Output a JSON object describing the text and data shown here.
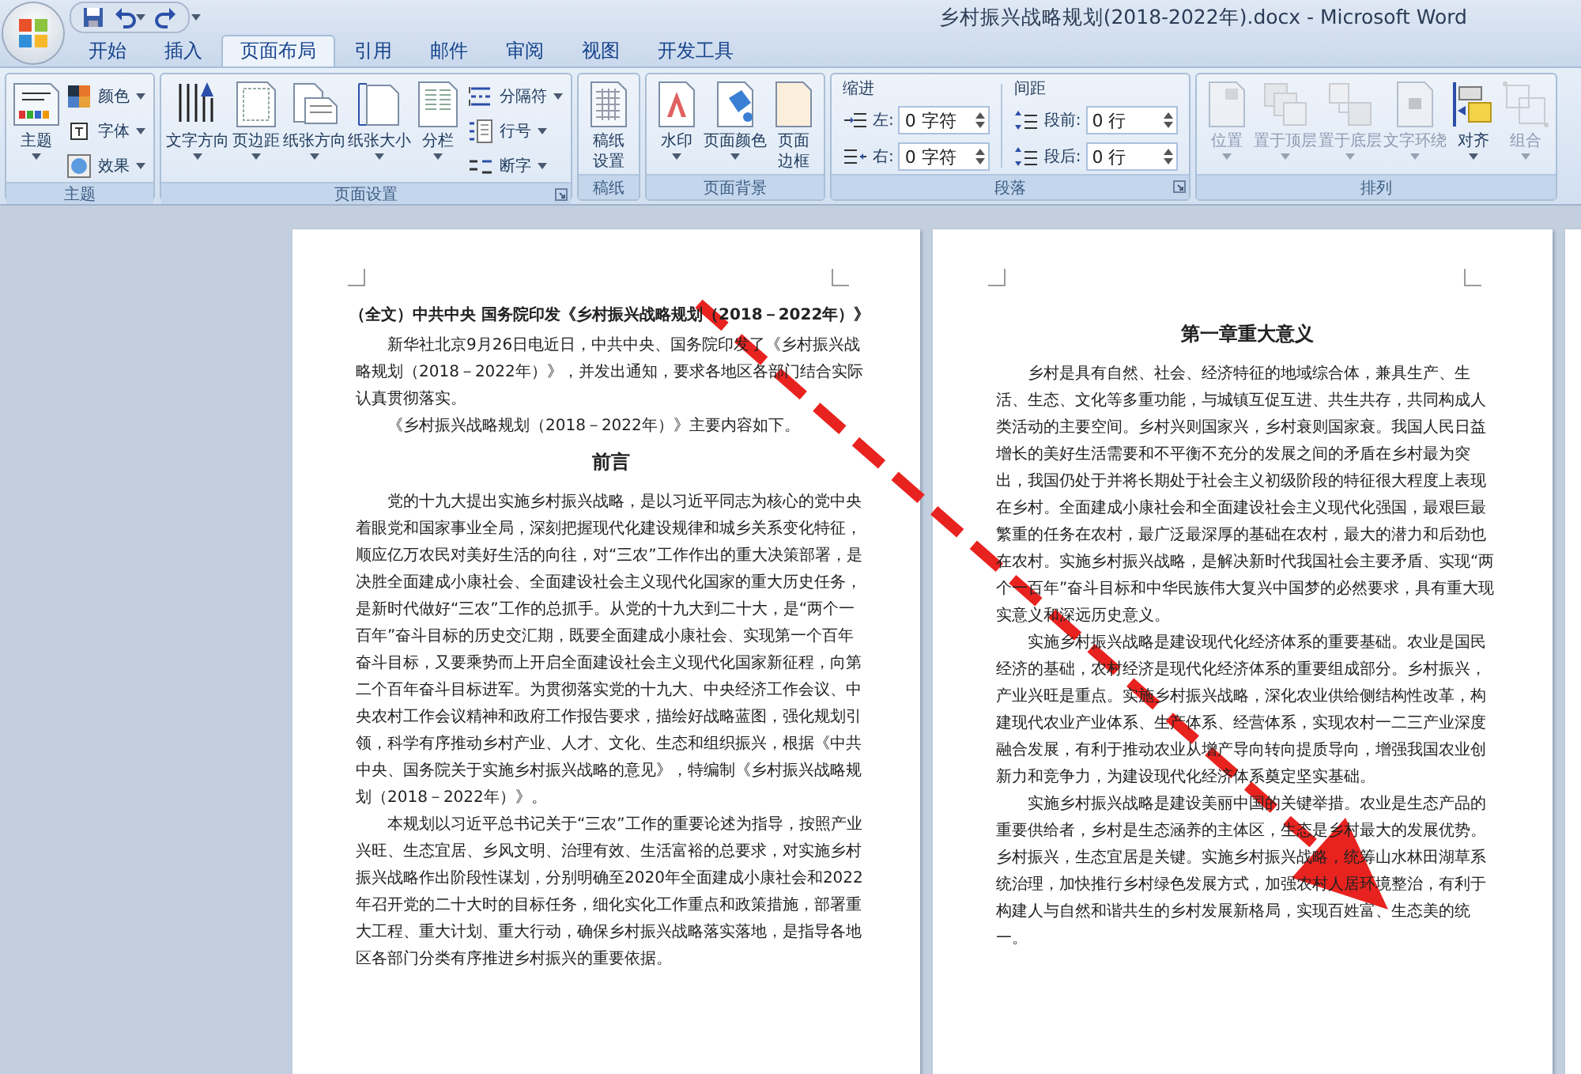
{
  "title_bar": {
    "title": "乡村振兴战略规划(2018-2022年).docx - Microsoft Word"
  },
  "tabs": [
    {
      "label": "开始",
      "selected": false
    },
    {
      "label": "插入",
      "selected": false
    },
    {
      "label": "页面布局",
      "selected": true
    },
    {
      "label": "引用",
      "selected": false
    },
    {
      "label": "邮件",
      "selected": false
    },
    {
      "label": "审阅",
      "selected": false
    },
    {
      "label": "视图",
      "selected": false
    },
    {
      "label": "开发工具",
      "selected": false
    }
  ],
  "ribbon": {
    "groups": [
      {
        "label": "主题",
        "launcher": false,
        "items": [
          {
            "kind": "large",
            "label": "主题",
            "dropdown": true,
            "disabled": false
          },
          {
            "kind": "stack",
            "items": [
              {
                "label": "颜色",
                "dropdown": true
              },
              {
                "label": "字体",
                "dropdown": true
              },
              {
                "label": "效果",
                "dropdown": true
              }
            ]
          }
        ]
      },
      {
        "label": "页面设置",
        "launcher": true,
        "items": [
          {
            "kind": "large",
            "label": "文字方向",
            "dropdown": true,
            "disabled": false
          },
          {
            "kind": "large",
            "label": "页边距",
            "dropdown": true,
            "disabled": false
          },
          {
            "kind": "large",
            "label": "纸张方向",
            "dropdown": true,
            "disabled": false
          },
          {
            "kind": "large",
            "label": "纸张大小",
            "dropdown": true,
            "disabled": false
          },
          {
            "kind": "large",
            "label": "分栏",
            "dropdown": true,
            "disabled": false
          },
          {
            "kind": "stack",
            "items": [
              {
                "label": "分隔符",
                "dropdown": true
              },
              {
                "label": "行号",
                "dropdown": true
              },
              {
                "label": "断字",
                "dropdown": true
              }
            ]
          }
        ]
      },
      {
        "label": "稿纸",
        "launcher": false,
        "items": [
          {
            "kind": "large",
            "label": "稿纸设置",
            "dropdown": false,
            "disabled": false
          }
        ]
      },
      {
        "label": "页面背景",
        "launcher": false,
        "items": [
          {
            "kind": "large",
            "label": "水印",
            "dropdown": true,
            "disabled": false
          },
          {
            "kind": "large",
            "label": "页面颜色",
            "dropdown": true,
            "disabled": false
          },
          {
            "kind": "large",
            "label": "页面边框",
            "dropdown": false,
            "disabled": false
          }
        ]
      },
      {
        "label": "段落",
        "launcher": true,
        "items": [
          {
            "kind": "spinners",
            "heading": "缩进",
            "rows": [
              {
                "label": "左:",
                "value": "0 字符"
              },
              {
                "label": "右:",
                "value": "0 字符"
              }
            ]
          },
          {
            "kind": "spinners",
            "heading": "间距",
            "rows": [
              {
                "label": "段前:",
                "value": "0 行"
              },
              {
                "label": "段后:",
                "value": "0 行"
              }
            ]
          }
        ]
      },
      {
        "label": "排列",
        "launcher": false,
        "items": [
          {
            "kind": "large",
            "label": "位置",
            "dropdown": true,
            "disabled": true
          },
          {
            "kind": "large",
            "label": "置于顶层",
            "dropdown": true,
            "disabled": true
          },
          {
            "kind": "large",
            "label": "置于底层",
            "dropdown": true,
            "disabled": true
          },
          {
            "kind": "large",
            "label": "文字环绕",
            "dropdown": true,
            "disabled": true
          },
          {
            "kind": "large",
            "label": "对齐",
            "dropdown": true,
            "disabled": false
          },
          {
            "kind": "large",
            "label": "组合",
            "dropdown": true,
            "disabled": true
          }
        ]
      }
    ]
  },
  "document": {
    "pages": [
      {
        "blocks": [
          {
            "kind": "title",
            "text": "（全文）中共中央 国务院印发《乡村振兴战略规划（2018－2022年）》"
          },
          {
            "kind": "para",
            "text": "新华社北京9月26日电近日，中共中央、国务院印发了《乡村振兴战略规划（2018－2022年）》，并发出通知，要求各地区各部门结合实际认真贯彻落实。"
          },
          {
            "kind": "para",
            "text": "《乡村振兴战略规划（2018－2022年）》主要内容如下。"
          },
          {
            "kind": "heading",
            "text": "前言"
          },
          {
            "kind": "para",
            "text": "党的十九大提出实施乡村振兴战略，是以习近平同志为核心的党中央着眼党和国家事业全局，深刻把握现代化建设规律和城乡关系变化特征，顺应亿万农民对美好生活的向往，对“三农”工作作出的重大决策部署，是决胜全面建成小康社会、全面建设社会主义现代化国家的重大历史任务，是新时代做好“三农”工作的总抓手。从党的十九大到二十大，是“两个一百年”奋斗目标的历史交汇期，既要全面建成小康社会、实现第一个百年奋斗目标，又要乘势而上开启全面建设社会主义现代化国家新征程，向第二个百年奋斗目标进军。为贯彻落实党的十九大、中央经济工作会议、中央农村工作会议精神和政府工作报告要求，描绘好战略蓝图，强化规划引领，科学有序推动乡村产业、人才、文化、生态和组织振兴，根据《中共中央、国务院关于实施乡村振兴战略的意见》，特编制《乡村振兴战略规划（2018－2022年）》。"
          },
          {
            "kind": "para",
            "text": "本规划以习近平总书记关于“三农”工作的重要论述为指导，按照产业兴旺、生态宜居、乡风文明、治理有效、生活富裕的总要求，对实施乡村振兴战略作出阶段性谋划，分别明确至2020年全面建成小康社会和2022年召开党的二十大时的目标任务，细化实化工作重点和政策措施，部署重大工程、重大计划、重大行动，确保乡村振兴战略落实落地，是指导各地区各部门分类有序推进乡村振兴的重要依据。"
          }
        ]
      },
      {
        "blocks": [
          {
            "kind": "heading",
            "text": "第一章重大意义"
          },
          {
            "kind": "para",
            "text": "乡村是具有自然、社会、经济特征的地域综合体，兼具生产、生活、生态、文化等多重功能，与城镇互促互进、共生共存，共同构成人类活动的主要空间。乡村兴则国家兴，乡村衰则国家衰。我国人民日益增长的美好生活需要和不平衡不充分的发展之间的矛盾在乡村最为突出，我国仍处于并将长期处于社会主义初级阶段的特征很大程度上表现在乡村。全面建成小康社会和全面建设社会主义现代化强国，最艰巨最繁重的任务在农村，最广泛最深厚的基础在农村，最大的潜力和后劲也在农村。实施乡村振兴战略，是解决新时代我国社会主要矛盾、实现“两个一百年”奋斗目标和中华民族伟大复兴中国梦的必然要求，具有重大现实意义和深远历史意义。"
          },
          {
            "kind": "para",
            "text": "实施乡村振兴战略是建设现代化经济体系的重要基础。农业是国民经济的基础，农村经济是现代化经济体系的重要组成部分。乡村振兴，产业兴旺是重点。实施乡村振兴战略，深化农业供给侧结构性改革，构建现代农业产业体系、生产体系、经营体系，实现农村一二三产业深度融合发展，有利于推动农业从增产导向转向提质导向，增强我国农业创新力和竞争力，为建设现代化经济体系奠定坚实基础。"
          },
          {
            "kind": "para",
            "text": "实施乡村振兴战略是建设美丽中国的关键举措。农业是生态产品的重要供给者，乡村是生态涵养的主体区，生态是乡村最大的发展优势。乡村振兴，生态宜居是关键。实施乡村振兴战略，统筹山水林田湖草系统治理，加快推行乡村绿色发展方式，加强农村人居环境整治，有利于构建人与自然和谐共生的乡村发展新格局，实现百姓富、生态美的统一。"
          }
        ]
      }
    ]
  }
}
